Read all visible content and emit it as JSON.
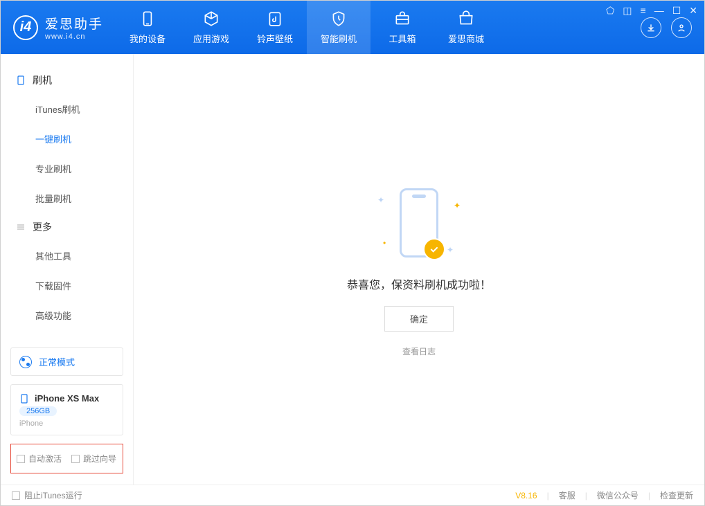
{
  "app": {
    "title": "爱思助手",
    "url": "www.i4.cn"
  },
  "tabs": [
    {
      "label": "我的设备"
    },
    {
      "label": "应用游戏"
    },
    {
      "label": "铃声壁纸"
    },
    {
      "label": "智能刷机"
    },
    {
      "label": "工具箱"
    },
    {
      "label": "爱思商城"
    }
  ],
  "sidebar": {
    "group1": {
      "title": "刷机",
      "items": [
        "iTunes刷机",
        "一键刷机",
        "专业刷机",
        "批量刷机"
      ]
    },
    "group2": {
      "title": "更多",
      "items": [
        "其他工具",
        "下载固件",
        "高级功能"
      ]
    }
  },
  "mode": {
    "label": "正常模式"
  },
  "device": {
    "name": "iPhone XS Max",
    "storage": "256GB",
    "type": "iPhone"
  },
  "options": {
    "auto_activate": "自动激活",
    "skip_guide": "跳过向导"
  },
  "main": {
    "success_msg": "恭喜您，保资料刷机成功啦！",
    "ok": "确定",
    "view_log": "查看日志"
  },
  "footer": {
    "block_itunes": "阻止iTunes运行",
    "version": "V8.16",
    "service": "客服",
    "wechat": "微信公众号",
    "update": "检查更新"
  }
}
